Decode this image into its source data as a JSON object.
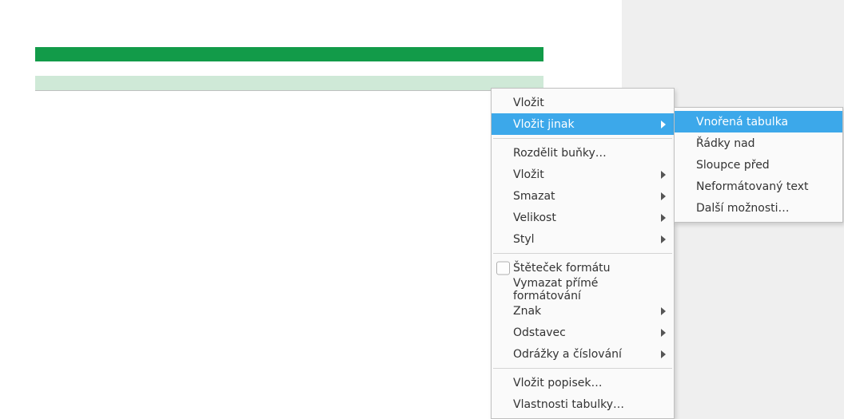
{
  "context_menu": {
    "items": [
      {
        "label": "Vložit",
        "type": "item"
      },
      {
        "label": "Vložit jinak",
        "type": "submenu",
        "highlighted": true
      },
      {
        "type": "separator"
      },
      {
        "label": "Rozdělit buňky…",
        "type": "item"
      },
      {
        "label": "Vložit",
        "type": "submenu"
      },
      {
        "label": "Smazat",
        "type": "submenu"
      },
      {
        "label": "Velikost",
        "type": "submenu"
      },
      {
        "label": "Styl",
        "type": "submenu"
      },
      {
        "type": "separator"
      },
      {
        "label": "Štěteček formátu",
        "type": "check"
      },
      {
        "label": "Vymazat přímé formátování",
        "type": "item"
      },
      {
        "label": "Znak",
        "type": "submenu"
      },
      {
        "label": "Odstavec",
        "type": "submenu"
      },
      {
        "label": "Odrážky a číslování",
        "type": "submenu"
      },
      {
        "type": "separator"
      },
      {
        "label": "Vložit popisek…",
        "type": "item"
      },
      {
        "label": "Vlastnosti tabulky…",
        "type": "item"
      }
    ]
  },
  "submenu": {
    "items": [
      {
        "label": "Vnořená tabulka",
        "highlighted": true
      },
      {
        "label": "Řádky nad"
      },
      {
        "label": "Sloupce před"
      },
      {
        "label": "Neformátovaný text"
      },
      {
        "label": "Další možnosti…"
      }
    ]
  },
  "colors": {
    "table_header": "#129b49",
    "table_row_alt": "#cfe9d7",
    "menu_highlight": "#3ca8ea"
  }
}
